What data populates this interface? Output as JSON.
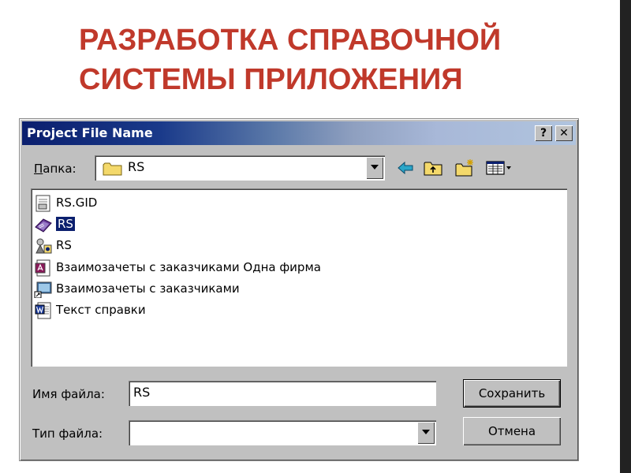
{
  "slide": {
    "title_line1": "РАЗРАБОТКА СПРАВОЧНОЙ",
    "title_line2": "СИСТЕМЫ ПРИЛОЖЕНИЯ"
  },
  "dialog": {
    "title": "Project File Name",
    "help_button": "?",
    "close_button": "✕",
    "folder_label": "Папка:",
    "folder_value": "RS",
    "files": [
      {
        "name": "RS.GID",
        "icon": "gid-file-icon",
        "selected": false
      },
      {
        "name": "RS",
        "icon": "help-book-icon",
        "selected": true
      },
      {
        "name": "RS",
        "icon": "help-project-icon",
        "selected": false
      },
      {
        "name": "Взаимозачеты с заказчиками Одна фирма",
        "icon": "access-file-icon",
        "selected": false
      },
      {
        "name": "Взаимозачеты с заказчиками",
        "icon": "shortcut-file-icon",
        "selected": false
      },
      {
        "name": "Текст справки",
        "icon": "word-document-icon",
        "selected": false
      }
    ],
    "filename_label": "Имя файла:",
    "filename_value": "RS",
    "filetype_label": "Тип файла:",
    "filetype_value": "",
    "save_button": "Сохранить",
    "cancel_button": "Отмена"
  }
}
